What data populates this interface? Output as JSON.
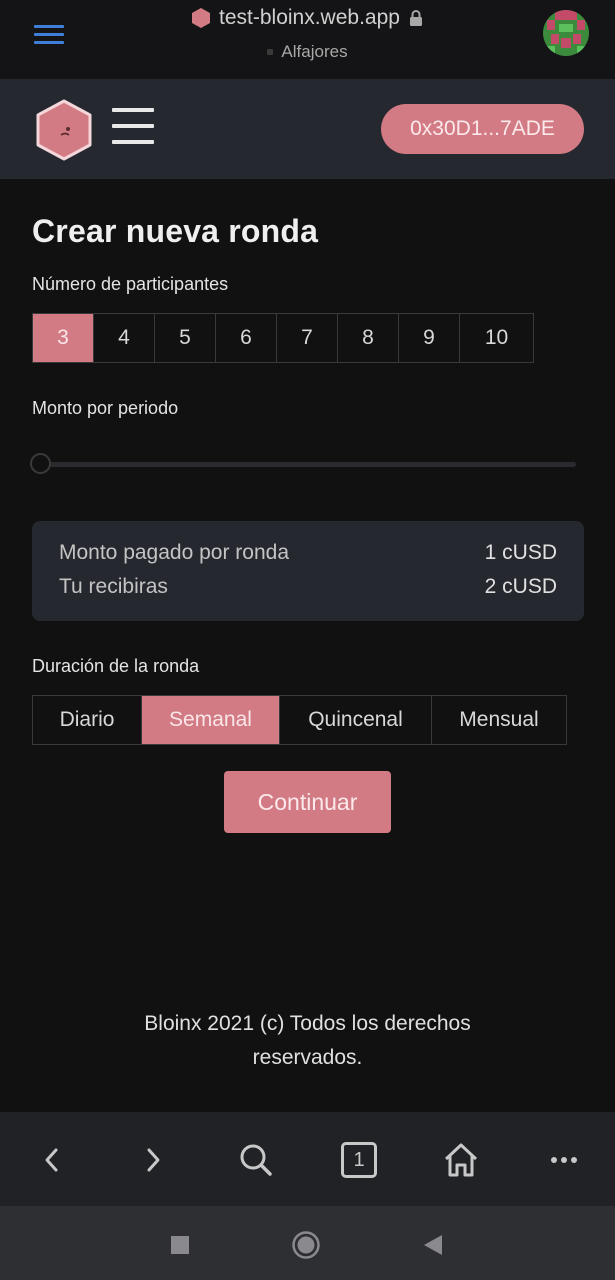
{
  "browser": {
    "url": "test-bloinx.web.app",
    "network": "Alfajores",
    "tab_count": "1"
  },
  "header": {
    "wallet_address": "0x30D1...7ADE"
  },
  "form": {
    "title": "Crear nueva ronda",
    "participants_label": "Número de participantes",
    "participants_options": [
      "3",
      "4",
      "5",
      "6",
      "7",
      "8",
      "9",
      "10"
    ],
    "participants_selected": "3",
    "amount_label": "Monto por periodo",
    "amount_slider_fraction": 0,
    "summary": {
      "paid_label": "Monto pagado por ronda",
      "paid_value": "1 cUSD",
      "receive_label": "Tu recibiras",
      "receive_value": "2 cUSD"
    },
    "duration_label": "Duración de la ronda",
    "duration_options": [
      "Diario",
      "Semanal",
      "Quincenal",
      "Mensual"
    ],
    "duration_selected": "Semanal",
    "continue_label": "Continuar"
  },
  "footer": {
    "line1": "Bloinx 2021 (c) Todos los derechos",
    "line2": "reservados."
  },
  "colors": {
    "accent": "#d37b84",
    "header_bg": "#25282e",
    "page_bg": "#111112",
    "browser_menu": "#3d7fd9"
  },
  "icons": {
    "browser_menu": "hamburger-icon",
    "site": "hexagon-logo-icon",
    "secure": "lock-icon",
    "back": "chevron-left-icon",
    "forward": "chevron-right-icon",
    "search": "search-icon",
    "home": "home-icon",
    "more": "more-dots-icon"
  }
}
